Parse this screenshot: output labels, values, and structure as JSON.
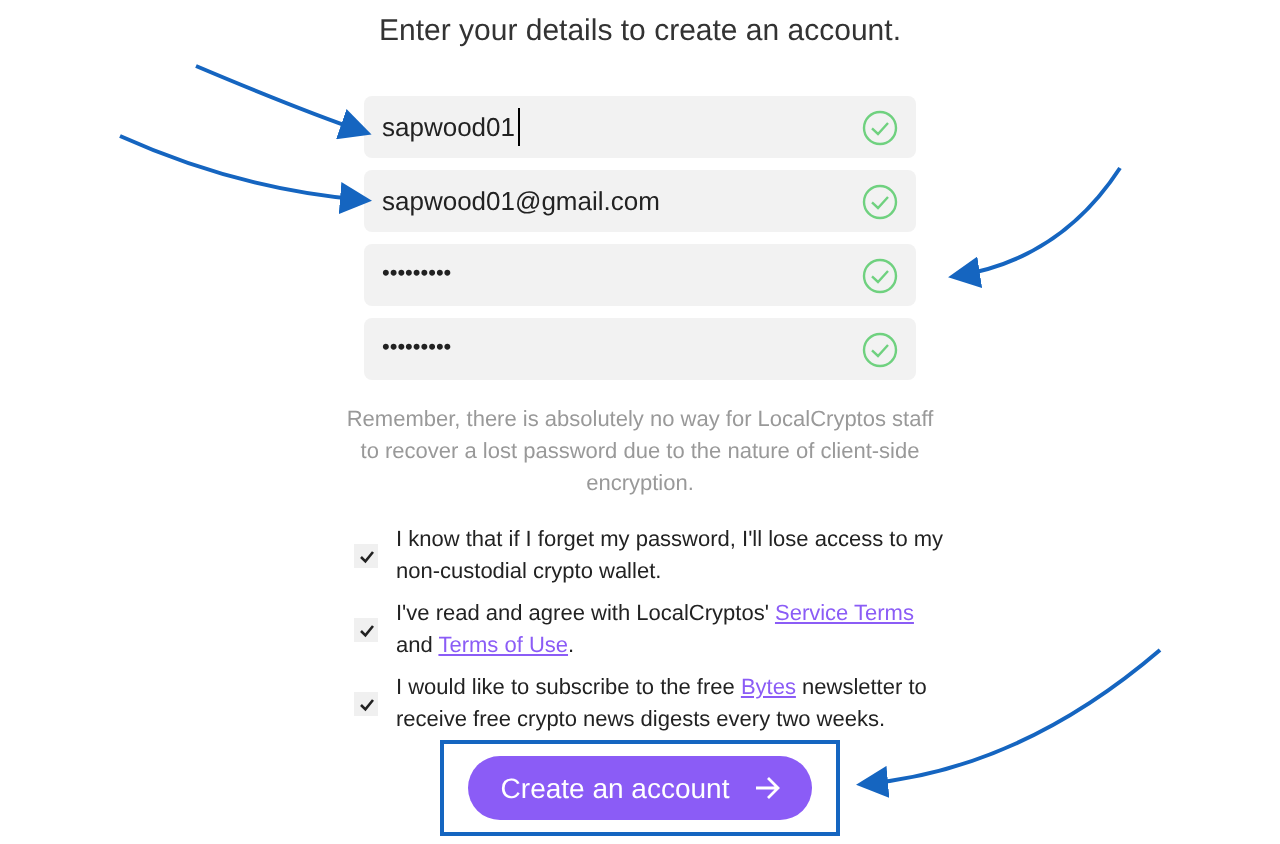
{
  "heading": "Enter your details to create an account.",
  "fields": [
    {
      "kind": "text",
      "value": "sapwood01",
      "focused": true,
      "valid": true
    },
    {
      "kind": "text",
      "value": "sapwood01@gmail.com",
      "focused": false,
      "valid": true
    },
    {
      "kind": "password",
      "value": "•••••••••",
      "focused": false,
      "valid": true
    },
    {
      "kind": "password",
      "value": "•••••••••",
      "focused": false,
      "valid": true
    }
  ],
  "note": "Remember, there is absolutely no way for LocalCryptos staff to recover a lost password due to the nature of client-side encryption.",
  "agreements": [
    {
      "checked": true,
      "parts": [
        {
          "kind": "text",
          "text": "I know that if I forget my password, I'll lose access to my non-custodial crypto wallet."
        }
      ]
    },
    {
      "checked": true,
      "parts": [
        {
          "kind": "text",
          "text": "I've read and agree with LocalCryptos' "
        },
        {
          "kind": "link",
          "text": "Service Terms"
        },
        {
          "kind": "text",
          "text": " and "
        },
        {
          "kind": "link",
          "text": "Terms of Use"
        },
        {
          "kind": "text",
          "text": "."
        }
      ]
    },
    {
      "checked": true,
      "parts": [
        {
          "kind": "text",
          "text": "I would like to subscribe to the free "
        },
        {
          "kind": "link",
          "text": "Bytes"
        },
        {
          "kind": "text",
          "text": " newsletter to receive free crypto news digests every two weeks."
        }
      ]
    }
  ],
  "submit": {
    "label": "Create an account",
    "highlighted": true
  }
}
